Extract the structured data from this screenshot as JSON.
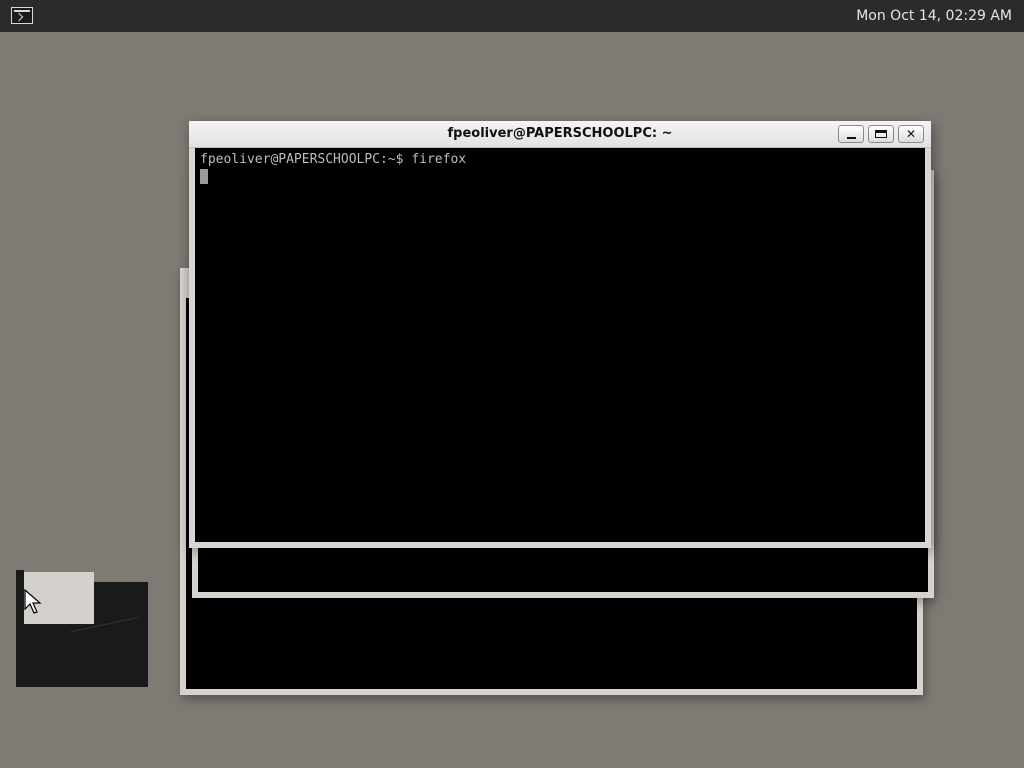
{
  "topbar": {
    "app_icon": "terminal-icon",
    "clock": "Mon Oct 14, 02:29 AM"
  },
  "terminal": {
    "title": "fpeoliver@PAPERSCHOOLPC: ~",
    "prompt": "fpeoliver@PAPERSCHOOLPC:~$ firefox",
    "buttons": {
      "minimize": "minimize-icon",
      "maximize": "maximize-icon",
      "close": "✕"
    }
  },
  "colors": {
    "desktop": "#7f7a74",
    "topbar": "#2b2b2b",
    "terminal_bg": "#000000",
    "terminal_text": "#bdbdbd"
  }
}
